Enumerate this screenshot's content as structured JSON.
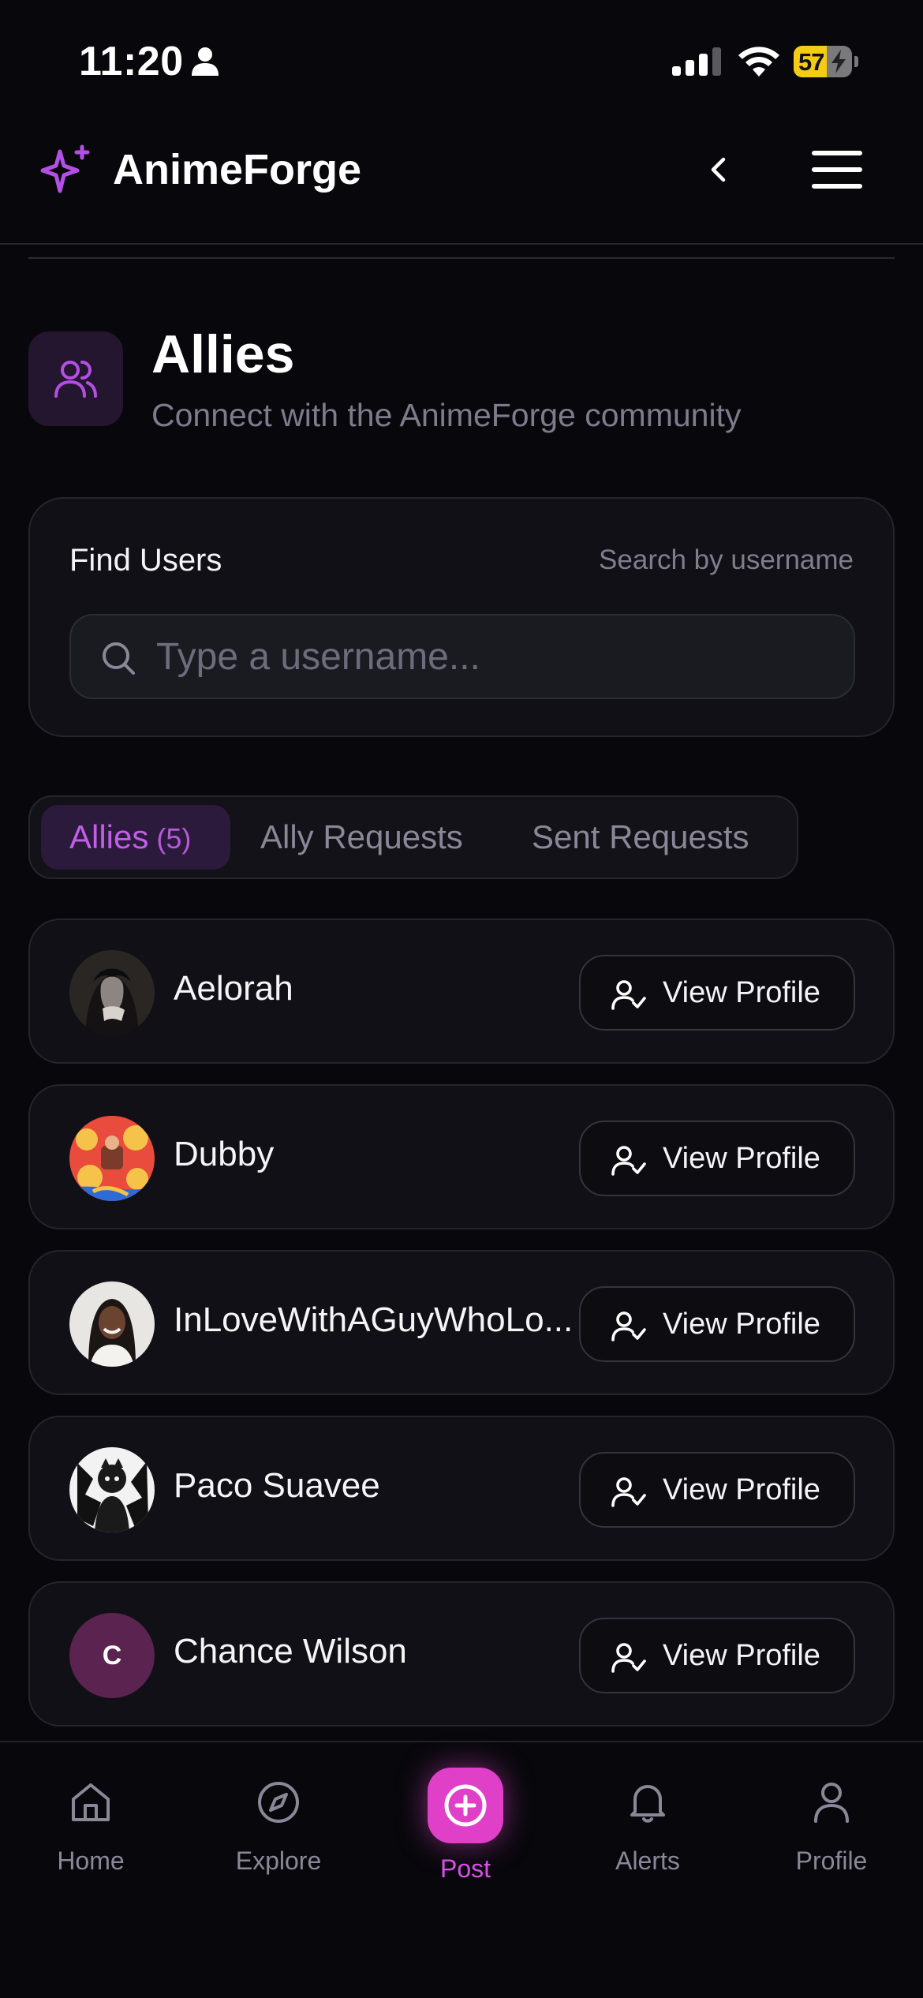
{
  "status_bar": {
    "time": "11:20",
    "battery": "57",
    "battery_level": 0.57
  },
  "header": {
    "app_name": "AnimeForge",
    "logo_icon": "sparkle-icon",
    "back_icon": "chevron-left-icon",
    "menu_icon": "hamburger-menu-icon"
  },
  "page": {
    "title": "Allies",
    "subtitle": "Connect with the AnimeForge community",
    "icon": "users-icon"
  },
  "find_users": {
    "label": "Find Users",
    "hint": "Search by username",
    "placeholder": "Type a username...",
    "value": ""
  },
  "tabs": [
    {
      "label": "Allies",
      "count": "(5)",
      "active": true
    },
    {
      "label": "Ally Requests",
      "active": false
    },
    {
      "label": "Sent Requests",
      "active": false
    }
  ],
  "allies": [
    {
      "name": "Aelorah",
      "action": "View Profile"
    },
    {
      "name": "Dubby",
      "action": "View Profile"
    },
    {
      "name": "InLoveWithAGuyWhoLo...",
      "action": "View Profile"
    },
    {
      "name": "Paco Suavee",
      "action": "View Profile"
    },
    {
      "name": "Chance Wilson",
      "initial": "C",
      "action": "View Profile"
    }
  ],
  "bottom_nav": [
    {
      "label": "Home",
      "icon": "home-icon"
    },
    {
      "label": "Explore",
      "icon": "compass-icon"
    },
    {
      "label": "Post",
      "icon": "plus-circle-icon",
      "active": true
    },
    {
      "label": "Alerts",
      "icon": "bell-icon"
    },
    {
      "label": "Profile",
      "icon": "user-icon"
    }
  ],
  "colors": {
    "accent": "#c35ee8",
    "post_button": "#e040c8",
    "background": "#08080c",
    "card": "#101016"
  }
}
